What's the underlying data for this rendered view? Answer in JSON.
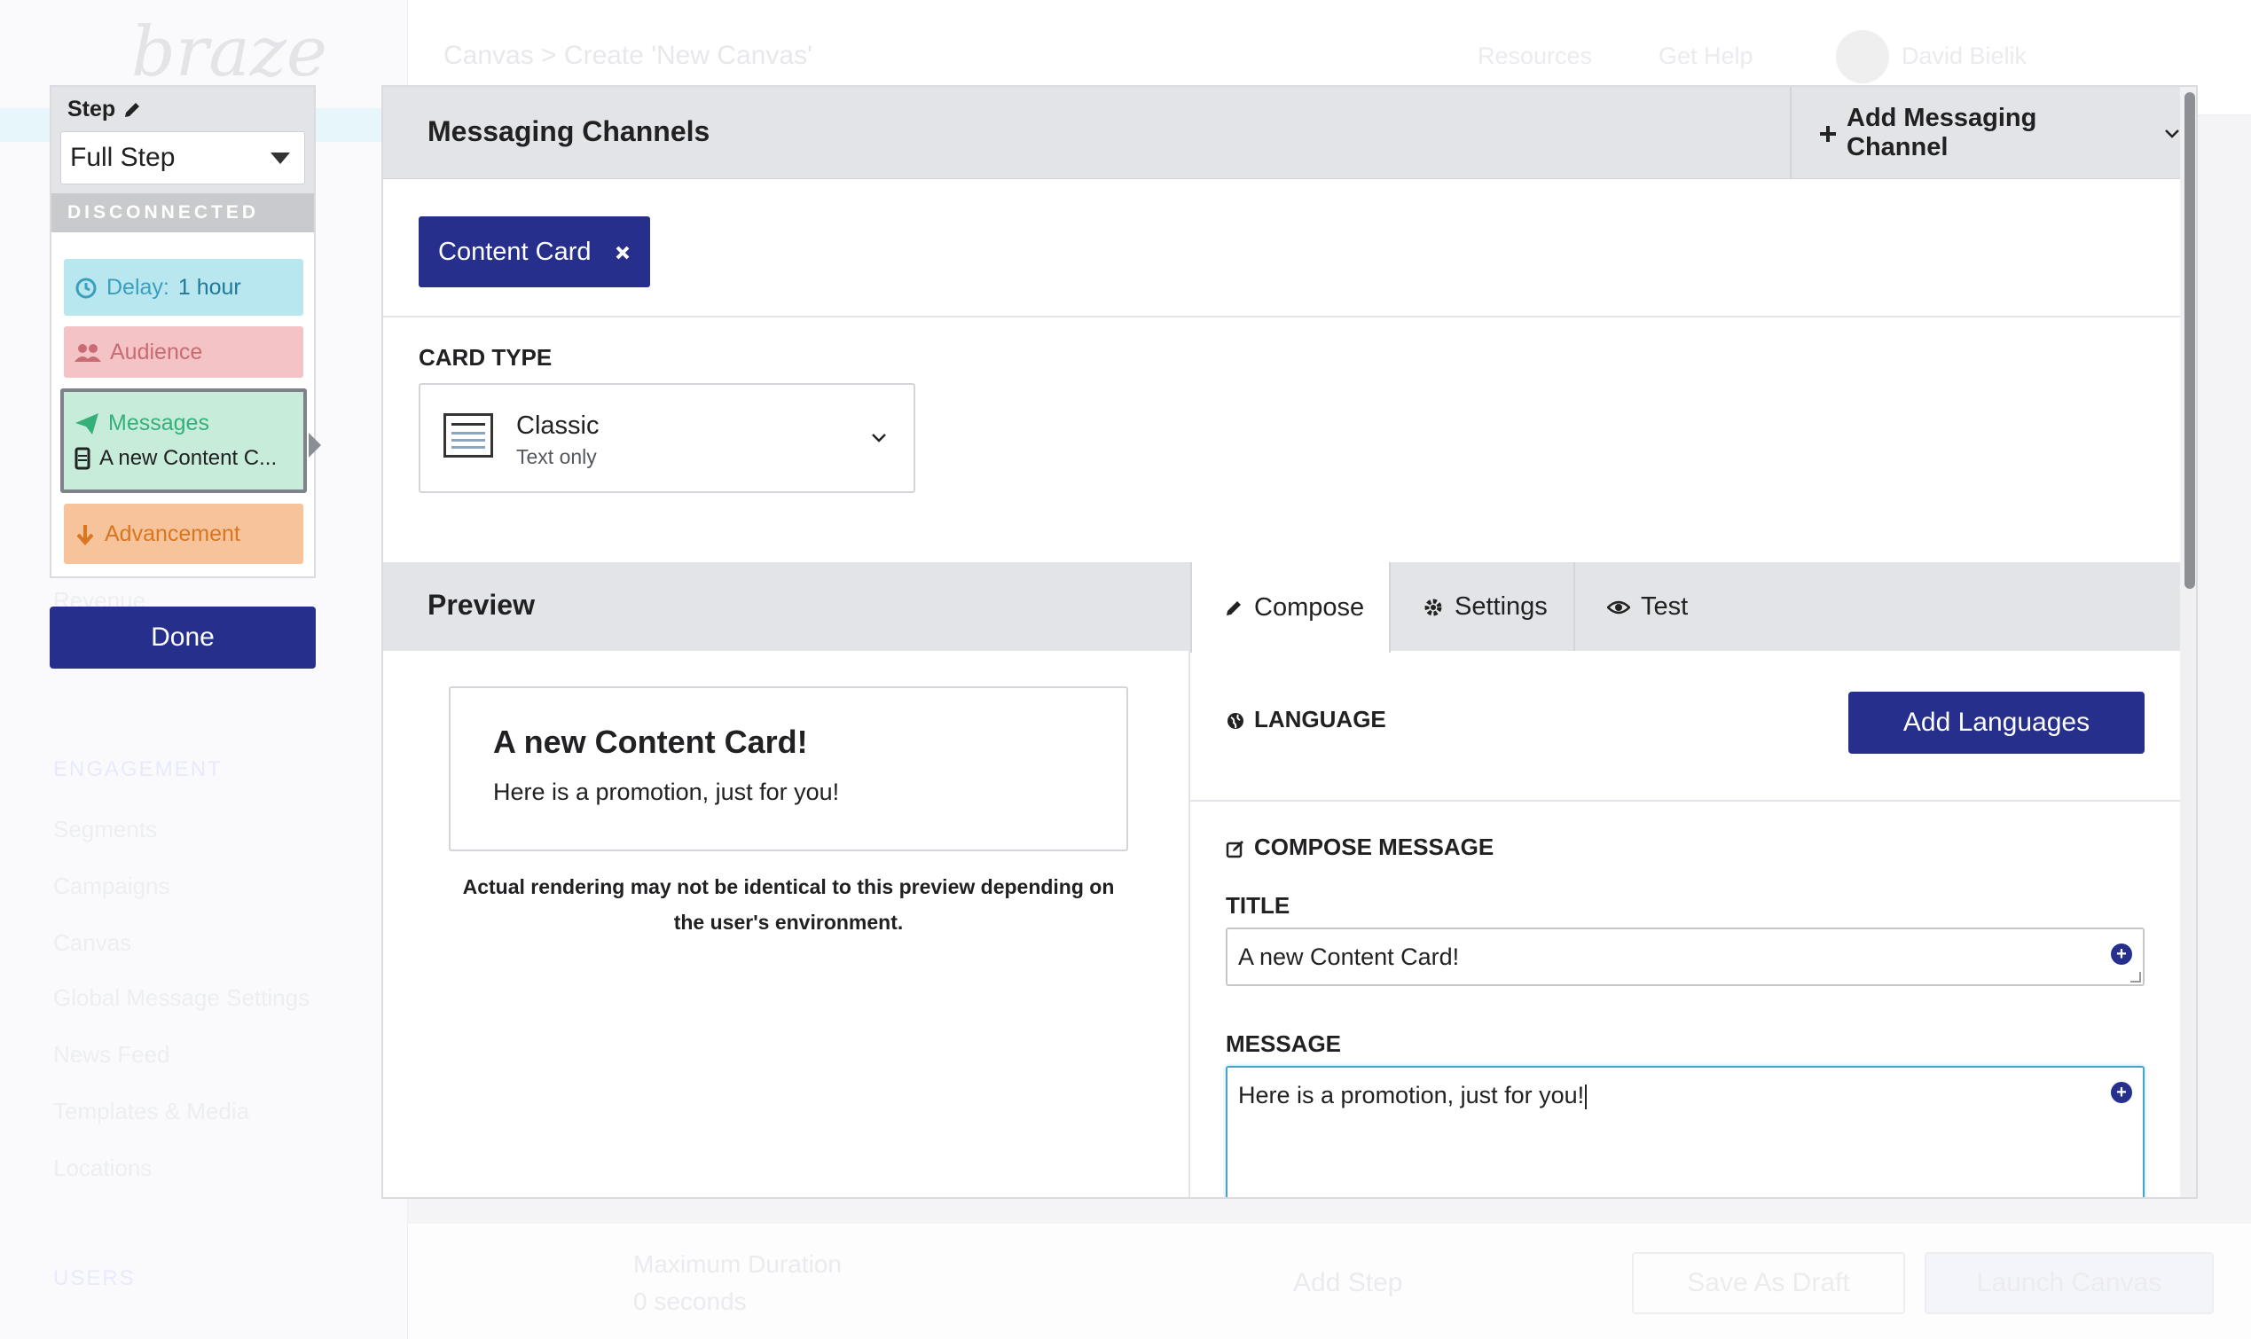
{
  "background": {
    "logo": "braze",
    "breadcrumb": "Canvas > Create 'New Canvas'",
    "header_items": [
      "Resources",
      "Get Help",
      "David Bielik"
    ],
    "nav": [
      "Revenue",
      "ENGAGEMENT",
      "Segments",
      "Campaigns",
      "Canvas",
      "Global Message Settings",
      "News Feed",
      "Templates & Media",
      "Locations",
      "USERS"
    ],
    "footer": {
      "max_duration_label": "Maximum Duration",
      "max_duration_value": "0 seconds",
      "add_step": "Add Step",
      "save_draft": "Save As Draft",
      "launch": "Launch Canvas"
    }
  },
  "step_panel": {
    "label": "Step",
    "select_value": "Full Step",
    "status": "DISCONNECTED",
    "delay_label": "Delay:",
    "delay_value": "1 hour",
    "audience": "Audience",
    "messages": "Messages",
    "message_item": "A new Content C...",
    "advancement": "Advancement",
    "done": "Done"
  },
  "channels": {
    "title": "Messaging Channels",
    "add_button": "Add Messaging Channel",
    "selected_channel": "Content Card"
  },
  "card_type": {
    "label": "CARD TYPE",
    "value": "Classic",
    "sub": "Text only"
  },
  "preview": {
    "title": "Preview",
    "card_title": "A new Content Card!",
    "card_message": "Here is a promotion, just for you!",
    "note": "Actual rendering may not be identical to this preview depending on the user's environment."
  },
  "tabs": [
    "Compose",
    "Settings",
    "Test"
  ],
  "compose": {
    "language_label": "LANGUAGE",
    "add_languages": "Add Languages",
    "compose_label": "COMPOSE MESSAGE",
    "title_label": "TITLE",
    "title_value": "A new Content Card!",
    "message_label": "MESSAGE",
    "message_value": "Here is a promotion, just for you!"
  },
  "colors": {
    "primary": "#262f8c",
    "delay_bg": "#b9e7f0",
    "audience_bg": "#f3c3c6",
    "messages_bg": "#c7ecd9",
    "advancement_bg": "#f6c39b"
  }
}
